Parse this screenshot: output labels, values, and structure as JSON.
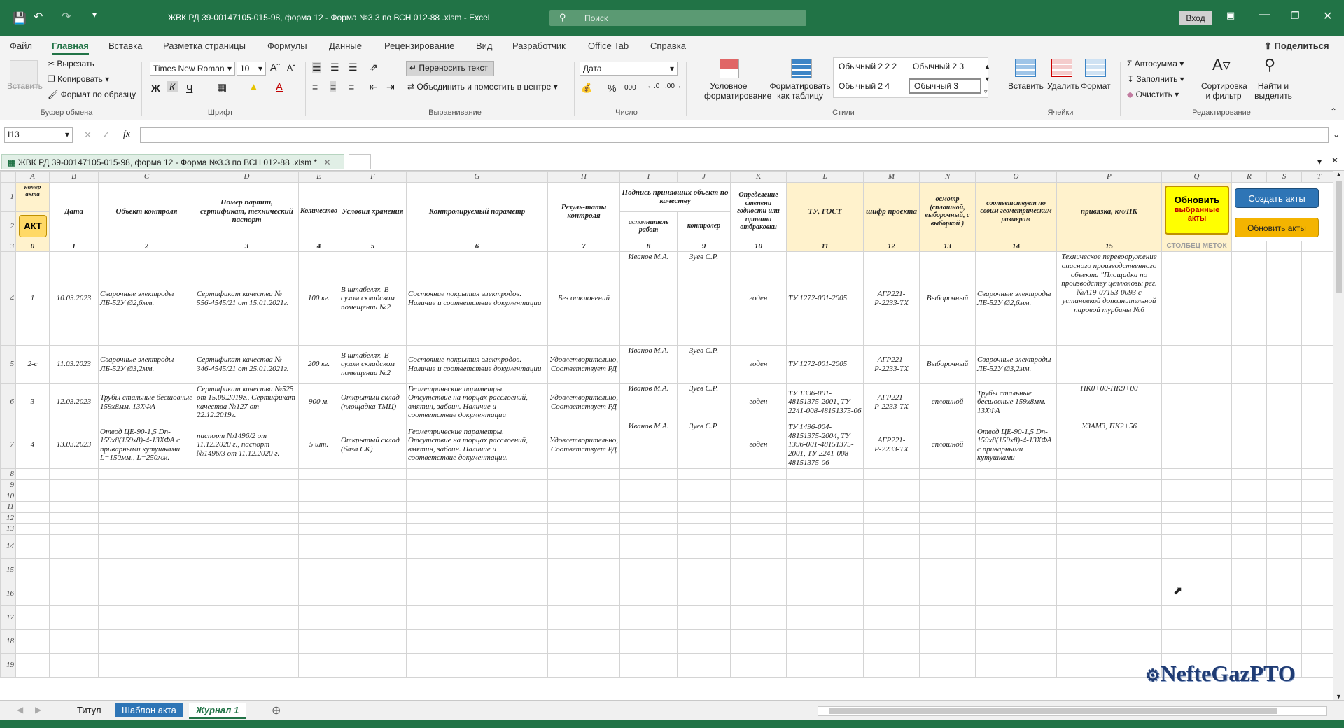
{
  "title": {
    "filename": "ЖВК РД 39-00147105-015-98, форма 12 - Форма №3.3 по ВСН 012-88 .xlsm",
    "app": "Excel",
    "search_placeholder": "Поиск",
    "login": "Вход"
  },
  "ribbon_tabs": [
    "Файл",
    "Главная",
    "Вставка",
    "Разметка страницы",
    "Формулы",
    "Данные",
    "Рецензирование",
    "Вид",
    "Разработчик",
    "Office Tab",
    "Справка"
  ],
  "share_label": "Поделиться",
  "ribbon": {
    "paste": "Вставить",
    "cut": "Вырезать",
    "copy": "Копировать",
    "format_painter": "Формат по образцу",
    "clipboard_group": "Буфер обмена",
    "font_name": "Times New Roman",
    "font_size": "10",
    "bold": "Ж",
    "italic": "К",
    "underline": "Ч",
    "font_group": "Шрифт",
    "wrap_text": "Переносить текст",
    "merge_center": "Объединить и поместить в центре",
    "alignment_group": "Выравнивание",
    "number_format": "Дата",
    "number_group": "Число",
    "cond_format": "Условное форматирование",
    "format_table": "Форматировать как таблицу",
    "styles": [
      "Обычный 2 2 2",
      "Обычный 2 3",
      "Обычный 2 4",
      "Обычный 3"
    ],
    "styles_group": "Стили",
    "insert": "Вставить",
    "delete": "Удалить",
    "format": "Формат",
    "cells_group": "Ячейки",
    "autosum": "Автосумма",
    "fill": "Заполнить",
    "clear": "Очистить",
    "sort_filter": "Сортировка и фильтр",
    "find_select": "Найти и выделить",
    "editing_group": "Редактирование"
  },
  "formula_bar": {
    "name_box": "I13",
    "fx": "fx",
    "formula": ""
  },
  "workbook_tab": "ЖВК РД 39-00147105-015-98, форма 12 - Форма №3.3 по ВСН 012-88 .xlsm *",
  "columns": [
    "A",
    "B",
    "C",
    "D",
    "E",
    "F",
    "G",
    "H",
    "I",
    "J",
    "K",
    "L",
    "M",
    "N",
    "O",
    "P",
    "Q",
    "R",
    "S",
    "T"
  ],
  "headers": {
    "a": "номер акта",
    "b": "Дата",
    "c": "Объект контроля",
    "d": "Номер партии, сертификат, технический паспорт",
    "e": "Количество",
    "f": "Условия хранения",
    "g": "Контролируемый параметр",
    "h": "Резуль-таты контроля",
    "ij": "Подпись принявших объект по качеству",
    "i": "исполнитель работ",
    "j": "контролер",
    "k": "Определение степени годности или причина отбраковки",
    "l": "ТУ, ГОСТ",
    "m": "шифр проекта",
    "n": "осмотр (сплошной, выборочный, с выборкой )",
    "o": "соответствует по своим геометрическим размерам",
    "p": "привязка, км/ПК"
  },
  "numbering": [
    "0",
    "1",
    "2",
    "3",
    "4",
    "5",
    "6",
    "7",
    "8",
    "9",
    "10",
    "11",
    "12",
    "13",
    "14",
    "15"
  ],
  "q3_label": "СТОЛБЕЦ МЕТОК",
  "buttons": {
    "akt": "АКТ",
    "refresh_selected_1": "Обновить",
    "refresh_selected_2": "выбранные акты",
    "create_acts": "Создать акты",
    "refresh_acts": "Обновить акты"
  },
  "rows": [
    {
      "row": "4",
      "a": "1",
      "b": "10.03.2023",
      "c": "Сварочные электроды ЛБ-52У Ø2,6мм.",
      "d": "Сертификат качества № 556-4545/21 от 15.01.2021г.",
      "e": "100 кг.",
      "f": "В штабелях. В сухом складском помещении №2",
      "g": "Состояние покрытия электродов. Наличие и соответствие документации",
      "h": "Без отклонений",
      "i": "Иванов М.А.",
      "j": "Зуев С.Р.",
      "k": "годен",
      "l": "ТУ 1272-001-2005",
      "m": "АГР221-Р-2233-ТХ",
      "n": "Выборочный",
      "o": "Сварочные электроды ЛБ-52У Ø2,6мм.",
      "p": "Техническое перевооружение опасного производственного объекта \"Площадка по производству целлюлозы рег. №А19-07153-0093 с установкой дополнительной паровой турбины №6"
    },
    {
      "row": "5",
      "a": "2-с",
      "b": "11.03.2023",
      "c": "Сварочные электроды ЛБ-52У Ø3,2мм.",
      "d": "Сертификат качества № 346-4545/21 от 25.01.2021г.",
      "e": "200 кг.",
      "f": "В штабелях. В сухом складском помещении №2",
      "g": "Состояние покрытия электродов. Наличие и соответствие документации",
      "h": "Удовлетворительно, Соответствует РД",
      "i": "Иванов М.А.",
      "j": "Зуев С.Р.",
      "k": "годен",
      "l": "ТУ 1272-001-2005",
      "m": "АГР221-Р-2233-ТХ",
      "n": "Выборочный",
      "o": "Сварочные электроды ЛБ-52У Ø3,2мм.",
      "p": "-"
    },
    {
      "row": "6",
      "a": "3",
      "b": "12.03.2023",
      "c": "Трубы стальные бесшовные 159х8мм. 13ХФА",
      "d": "Сертификат качества №525 от 15.09.2019г., Сертификат качества №127 от 22.12.2019г.",
      "e": "900 м.",
      "f": "Открытый склад (площадка ТМЦ)",
      "g": "Геометрические параметры. Отсутствие на торцах расслоений, вмятин, забоин. Наличие и соответствие документации",
      "h": "Удовлетворительно, Соответствует РД",
      "i": "Иванов М.А.",
      "j": "Зуев С.Р.",
      "k": "годен",
      "l": "ТУ 1396-001-48151375-2001, ТУ 2241-008-48151375-06",
      "m": "АГР221-Р-2233-ТХ",
      "n": "сплошной",
      "o": "Трубы стальные бесшовные 159х8мм. 13ХФА",
      "p": "ПК0+00-ПК9+00"
    },
    {
      "row": "7",
      "a": "4",
      "b": "13.03.2023",
      "c": "Отвод ЦЕ-90-1,5 Dn-159х8(159х8)-4-13ХФА с приварными кутушками L=150мм., L=250мм.",
      "d": "паспорт №1496/2 от 11.12.2020 г., паспорт №1496/3 от 11.12.2020 г.",
      "e": "5 шт.",
      "f": "Открытый склад (база СК)",
      "g": "Геометрические параметры. Отсутствие на торцах расслоений, вмятин, забоин. Наличие и соответствие документации.",
      "h": "Удовлетворительно, Соответствует РД",
      "i": "Иванов М.А.",
      "j": "Зуев С.Р.",
      "k": "годен",
      "l": "ТУ 1496-004-48151375-2004, ТУ 1396-001-48151375-2001, ТУ 2241-008-48151375-06",
      "m": "АГР221-Р-2233-ТХ",
      "n": "сплошной",
      "o": "Отвод ЦЕ-90-1,5 Dn-159х8(159х8)-4-13ХФА с приварными кутушками",
      "p": "УЗАМ3, ПК2+56"
    }
  ],
  "empty_rows": [
    "8",
    "9",
    "10",
    "11",
    "12",
    "13",
    "14",
    "15",
    "16",
    "17",
    "18",
    "19"
  ],
  "sheet_tabs": [
    "Титул",
    "Шаблон акта",
    "Журнал 1"
  ],
  "watermark": "NefteGazPTO"
}
